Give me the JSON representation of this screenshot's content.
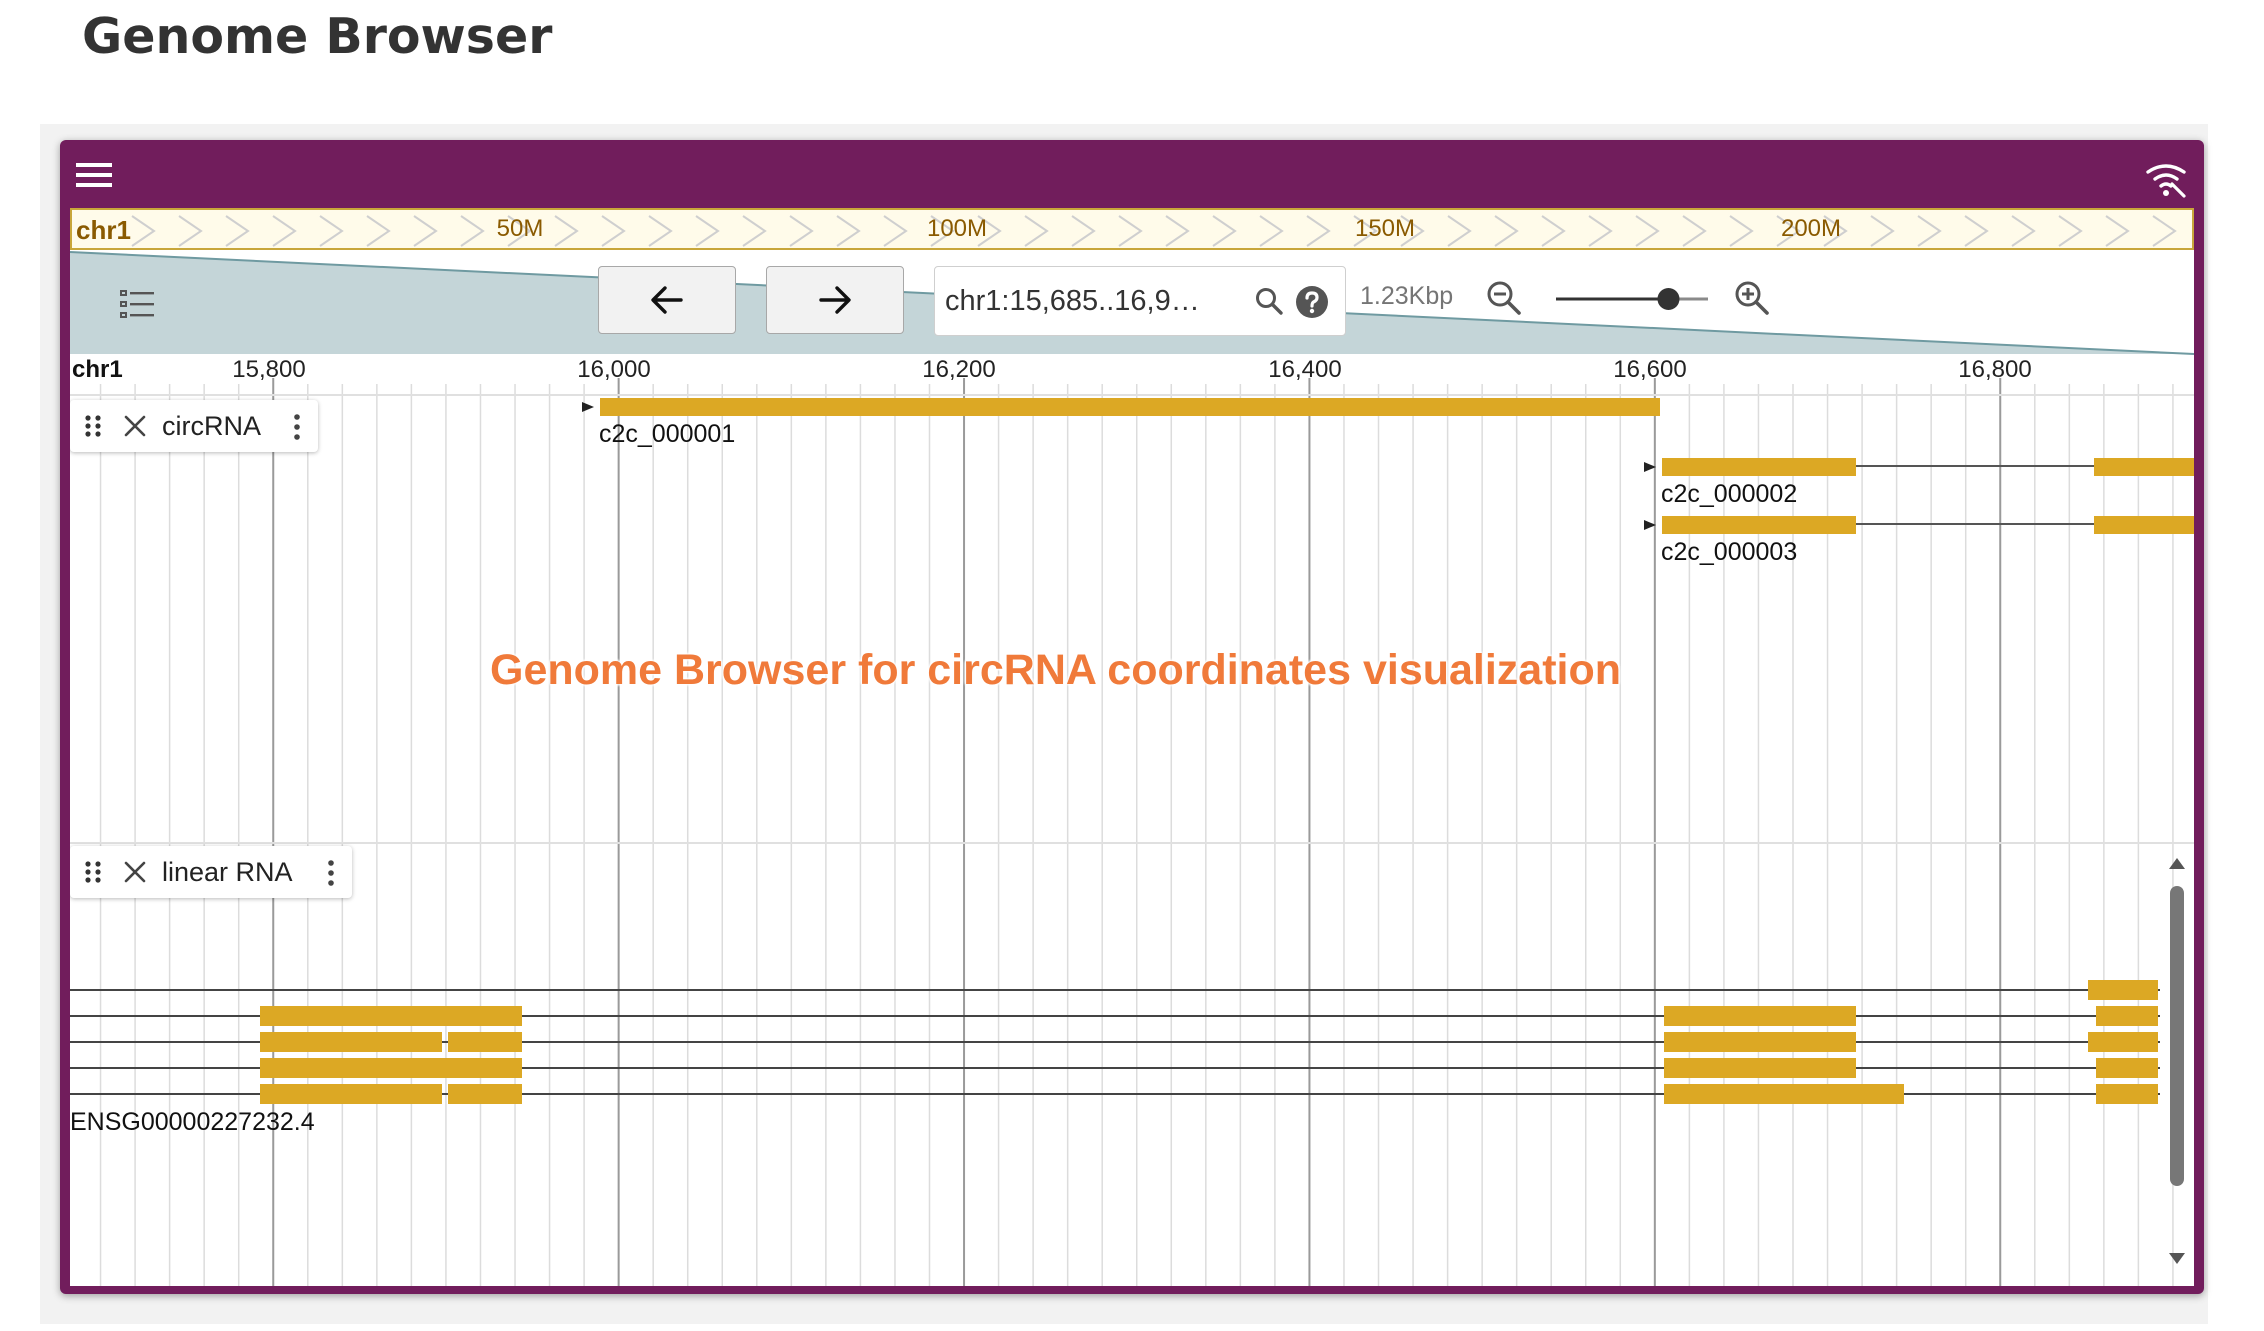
{
  "page": {
    "title": "Genome Browser"
  },
  "overview": {
    "chromosome": "chr1",
    "ticks": [
      "50M",
      "100M",
      "150M",
      "200M"
    ]
  },
  "navigation": {
    "location": "chr1:15,685..16,9…",
    "bp_per_view": "1.23Kbp",
    "zoom_level": 0.74
  },
  "ruler": {
    "chromosome": "chr1",
    "ticks": [
      "15,800",
      "16,000",
      "16,200",
      "16,400",
      "16,600",
      "16,800"
    ]
  },
  "tracks": {
    "circrna": {
      "name": "circRNA",
      "features": [
        {
          "label": "c2c_000001"
        },
        {
          "label": "c2c_000002"
        },
        {
          "label": "c2c_000003"
        }
      ]
    },
    "linear": {
      "name": "linear RNA",
      "gene_label": "ENSG00000227232.4"
    }
  },
  "annotation": {
    "text": "Genome Browser for circRNA coordinates visualization"
  },
  "colors": {
    "frame": "#711d5c",
    "feature": "#dca824",
    "overview_band": "#fffbea",
    "watermark": "#f07a3a"
  }
}
